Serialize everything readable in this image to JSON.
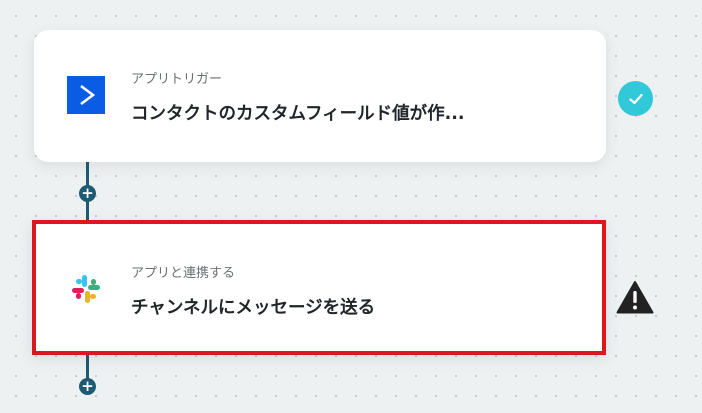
{
  "flow": {
    "steps": [
      {
        "label": "アプリトリガー",
        "title": "コンタクトのカスタムフィールド値が作...",
        "icon": "activecampaign-icon",
        "status": "check-icon",
        "accent": "#0b5ce5"
      },
      {
        "label": "アプリと連携する",
        "title": "チャンネルにメッセージを送る",
        "icon": "slack-icon",
        "status": "warning-icon"
      }
    ],
    "add_symbol": "+"
  },
  "colors": {
    "connector": "#1d5a73",
    "check": "#31c8d8",
    "highlight_border": "#e0161d",
    "warning": "#222222"
  }
}
